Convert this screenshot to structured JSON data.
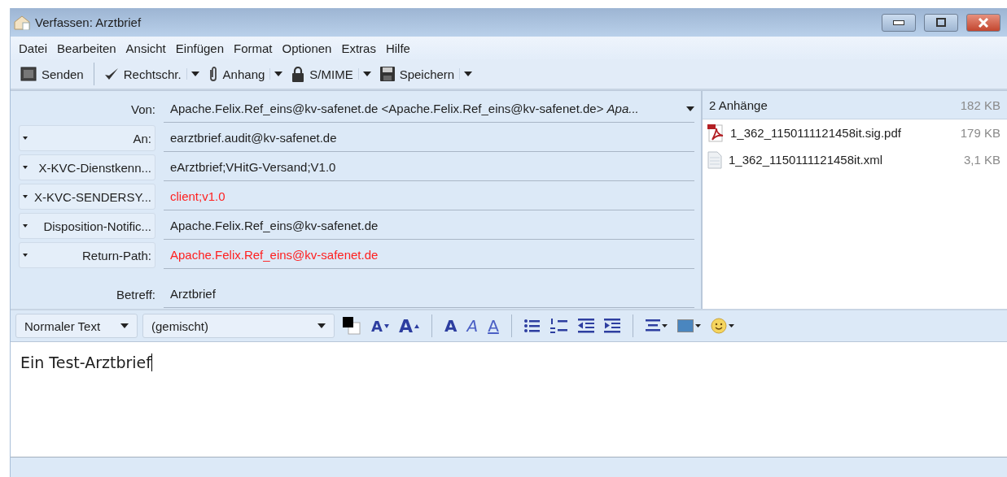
{
  "window": {
    "title": "Verfassen: Arztbrief"
  },
  "menu": [
    {
      "label": "Datei"
    },
    {
      "label": "Bearbeiten"
    },
    {
      "label": "Ansicht"
    },
    {
      "label": "Einfügen"
    },
    {
      "label": "Format"
    },
    {
      "label": "Optionen"
    },
    {
      "label": "Extras"
    },
    {
      "label": "Hilfe"
    }
  ],
  "toolbar": [
    {
      "kind": "send",
      "label": "Senden",
      "dropdown": false
    },
    {
      "kind": "spell",
      "label": "Rechtschr.",
      "dropdown": true
    },
    {
      "kind": "attach",
      "label": "Anhang",
      "dropdown": true
    },
    {
      "kind": "lock",
      "label": "S/MIME",
      "dropdown": true
    },
    {
      "kind": "save",
      "label": "Speichern",
      "dropdown": true
    }
  ],
  "headers": [
    {
      "kind": "fixed",
      "label": "Von:",
      "value": "Apache.Felix.Ref_eins@kv-safenet.de <Apache.Felix.Ref_eins@kv-safenet.de> *Apa...*",
      "dropdown": true,
      "color": "#1e1e1e"
    },
    {
      "kind": "selectable",
      "label": "An:",
      "value": "earztbrief.audit@kv-safenet.de",
      "color": "#1e1e1e"
    },
    {
      "kind": "selectable",
      "label": "X-KVC-Dienstkenn...",
      "value": "eArztbrief;VHitG-Versand;V1.0",
      "color": "#1e1e1e"
    },
    {
      "kind": "selectable",
      "label": "X-KVC-SENDERSY...",
      "value": "client;v1.0",
      "color": "#ff2020"
    },
    {
      "kind": "selectable",
      "label": "Disposition-Notific...",
      "value": "Apache.Felix.Ref_eins@kv-safenet.de",
      "color": "#1e1e1e"
    },
    {
      "kind": "selectable",
      "label": "Return-Path:",
      "value": "Apache.Felix.Ref_eins@kv-safenet.de",
      "color": "#ff2020"
    },
    {
      "kind": "spacer"
    },
    {
      "kind": "fixed",
      "label": "Betreff:",
      "value": "Arztbrief",
      "dropdown": false,
      "color": "#1e1e1e"
    }
  ],
  "attachments": {
    "title": "2 Anhänge",
    "total": "182 KB",
    "items": [
      {
        "kind": "pdf",
        "name": "1_362_1150111121458it.sig.pdf",
        "size": "179 KB"
      },
      {
        "kind": "file",
        "name": "1_362_1150111121458it.xml",
        "size": "3,1 KB"
      }
    ]
  },
  "format_bar": {
    "paragraph": "Normaler Text",
    "font": "(gemischt)",
    "buttons": [
      {
        "kind": "color"
      },
      {
        "kind": "smaller",
        "glyph": "A"
      },
      {
        "kind": "larger",
        "glyph": "A"
      },
      {
        "kind": "sep"
      },
      {
        "kind": "bold",
        "glyph": "A"
      },
      {
        "kind": "italic",
        "glyph": "A"
      },
      {
        "kind": "underline",
        "glyph": "A"
      },
      {
        "kind": "sep"
      },
      {
        "kind": "bullets"
      },
      {
        "kind": "numbers"
      },
      {
        "kind": "outdent"
      },
      {
        "kind": "indent"
      },
      {
        "kind": "sep"
      },
      {
        "kind": "align"
      },
      {
        "kind": "image"
      },
      {
        "kind": "smiley"
      }
    ]
  },
  "body": {
    "text": "Ein Test-Arztbrief"
  }
}
